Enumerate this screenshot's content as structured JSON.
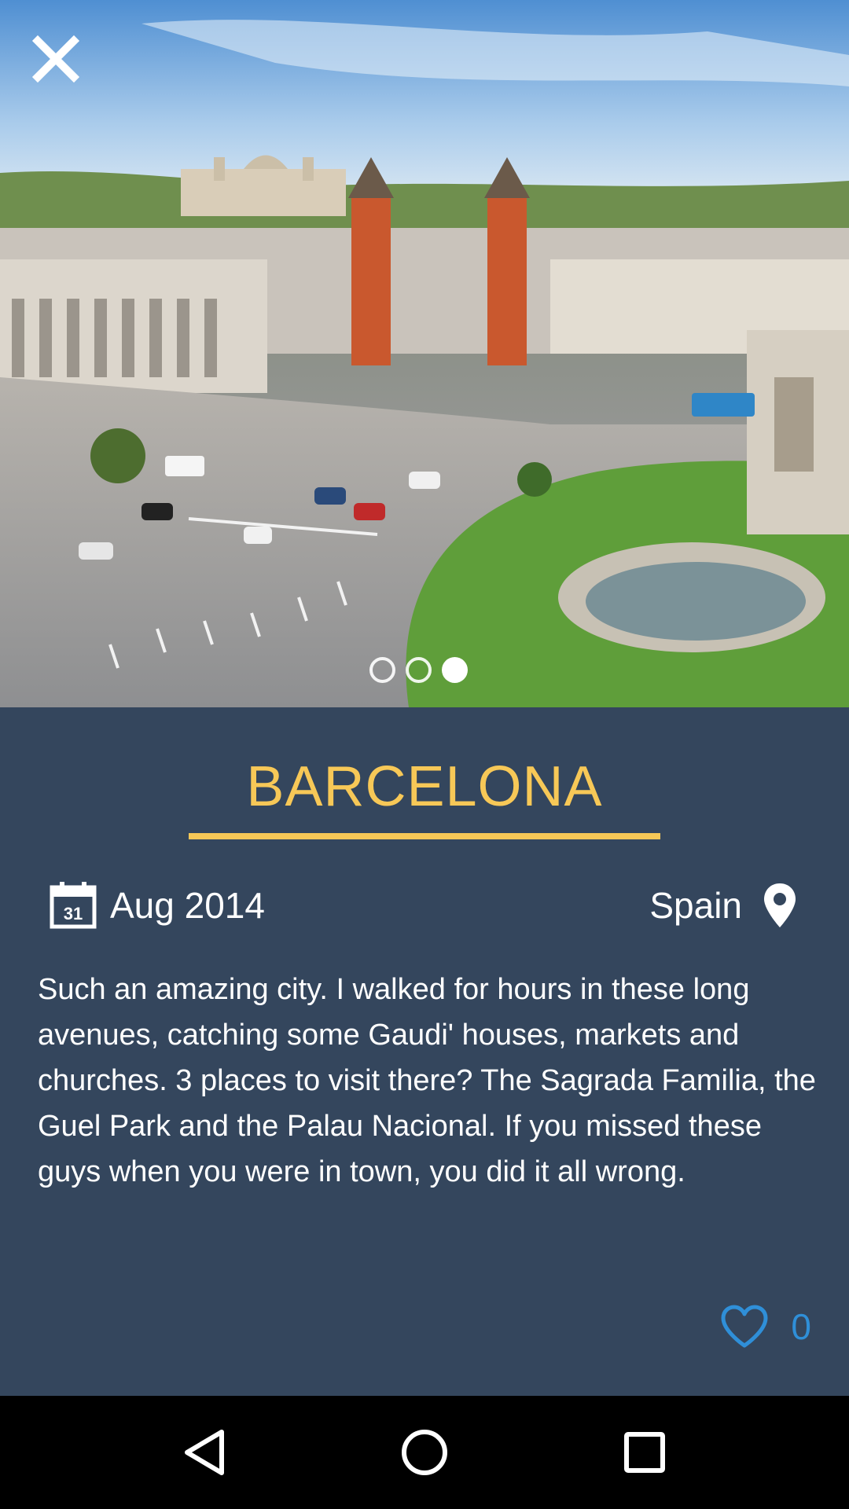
{
  "post": {
    "title": "BARCELONA",
    "date": "Aug 2014",
    "calendar_day": "31",
    "country": "Spain",
    "description": "Such an amazing city. I walked for hours in these long avenues, catching some Gaudi' houses, markets and churches. 3 places to visit there? The Sagrada Familia, the Guel Park and the Palau Nacional. If you missed these guys when you were in town, you did it all wrong.",
    "like_count": "0"
  },
  "gallery": {
    "image_count": 3,
    "active_index": 2
  },
  "icons": {
    "close": "close-icon",
    "calendar": "calendar-icon",
    "location": "location-pin-icon",
    "like": "heart-icon",
    "nav_back": "back-triangle-icon",
    "nav_home": "home-circle-icon",
    "nav_recents": "recents-square-icon"
  },
  "colors": {
    "panel_bg": "#34465d",
    "title_accent": "#f7c857",
    "like_accent": "#2f8fd8",
    "navbar_bg": "#000000"
  }
}
